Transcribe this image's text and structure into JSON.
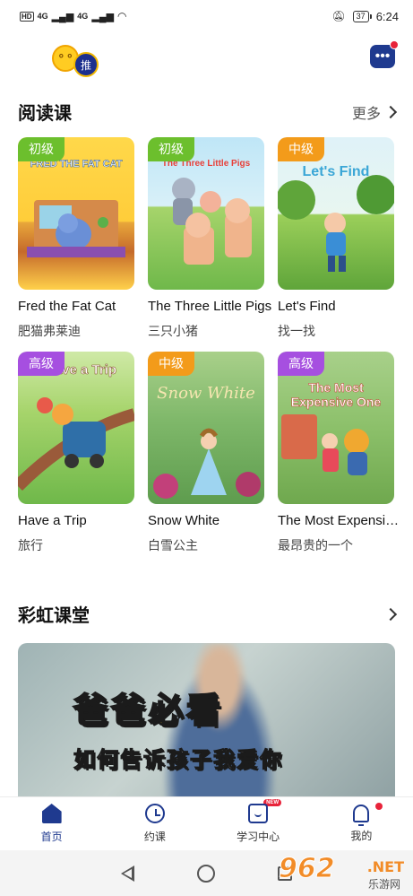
{
  "status_bar": {
    "left_badge": "HD",
    "signal1": "4G",
    "signal2": "4G",
    "battery": "37",
    "time": "6:24"
  },
  "header": {
    "logo_face": "° °",
    "logo_badge": "推",
    "message_icon": "message-icon",
    "message_dots": "•••"
  },
  "reading": {
    "title": "阅读课",
    "more_label": "更多",
    "books": [
      {
        "level": "初级",
        "level_color": "#6cbf2d",
        "cover_text": "FRED THE FAT CAT",
        "title": "Fred the Fat Cat",
        "subtitle": "肥猫弗莱迪"
      },
      {
        "level": "初级",
        "level_color": "#6cbf2d",
        "cover_text": "The Three Little Pigs",
        "title": "The Three Little Pigs",
        "subtitle": "三只小猪"
      },
      {
        "level": "中级",
        "level_color": "#f39b1a",
        "cover_text": "Let's Find",
        "title": "Let's Find",
        "subtitle": "找一找"
      },
      {
        "level": "高级",
        "level_color": "#a64fe0",
        "cover_text": "Have a Trip",
        "title": "Have a Trip",
        "subtitle": "旅行"
      },
      {
        "level": "中级",
        "level_color": "#f39b1a",
        "cover_text": "Snow White",
        "title": "Snow White",
        "subtitle": "白雪公主"
      },
      {
        "level": "高级",
        "level_color": "#a64fe0",
        "cover_text": "The Most Expensive One",
        "title": "The Most Expensive One",
        "subtitle": "最昂贵的一个"
      }
    ]
  },
  "rainbow": {
    "title": "彩虹课堂",
    "banner_line1": "爸爸必看",
    "banner_line2": "如何告诉孩子我爱你"
  },
  "tabs": [
    {
      "label": "首页",
      "icon": "home-icon",
      "active": true
    },
    {
      "label": "约课",
      "icon": "clock-icon",
      "active": false
    },
    {
      "label": "学习中心",
      "icon": "study-icon",
      "active": false,
      "badge": "NEW"
    },
    {
      "label": "我的",
      "icon": "bell-icon",
      "active": false
    }
  ],
  "watermark": {
    "main": "962",
    "net": ".NET",
    "sub": "乐游网"
  }
}
